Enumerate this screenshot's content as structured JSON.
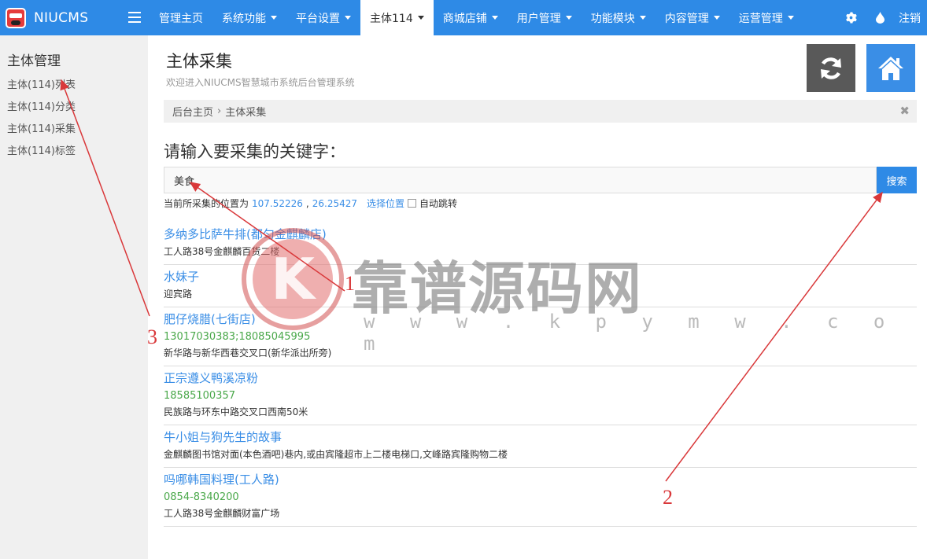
{
  "brand": {
    "name": "NIUCMS",
    "logo_text": "NIUCMS"
  },
  "menu": [
    {
      "label": "管理主页",
      "caret": false,
      "active": false
    },
    {
      "label": "系统功能",
      "caret": true,
      "active": false
    },
    {
      "label": "平台设置",
      "caret": true,
      "active": false
    },
    {
      "label": "主体114",
      "caret": true,
      "active": true
    },
    {
      "label": "商城店铺",
      "caret": true,
      "active": false
    },
    {
      "label": "用户管理",
      "caret": true,
      "active": false
    },
    {
      "label": "功能模块",
      "caret": true,
      "active": false
    },
    {
      "label": "内容管理",
      "caret": true,
      "active": false
    },
    {
      "label": "运营管理",
      "caret": true,
      "active": false
    }
  ],
  "nav_right": {
    "settings_icon": "gear-icon",
    "theme_icon": "drop-icon",
    "logout_label": "注销"
  },
  "sidebar": {
    "title": "主体管理",
    "items": [
      {
        "label": "主体(114)列表"
      },
      {
        "label": "主体(114)分类"
      },
      {
        "label": "主体(114)采集"
      },
      {
        "label": "主体(114)标签"
      }
    ]
  },
  "page": {
    "title": "主体采集",
    "subtitle": "欢迎进入NIUCMS智慧城市系统后台管理系统",
    "refresh_icon": "refresh-icon",
    "home_icon": "home-icon",
    "refresh_color": "#595959",
    "home_color": "#3a8ee6"
  },
  "breadcrumb": {
    "home": "后台主页",
    "sep": "›",
    "current": "主体采集",
    "close": "✖"
  },
  "search": {
    "label": "请输入要采集的关键字：",
    "value": "美食",
    "button": "搜索"
  },
  "location": {
    "prefix": "当前所采集的位置为",
    "lng": "107.52226",
    "sep": ",",
    "lat": "26.25427",
    "choose": "选择位置",
    "auto_jump": "自动跳转"
  },
  "results": [
    {
      "name": "多纳多比萨牛排(都匀金麒麟店)",
      "phone": "",
      "address": "工人路38号金麒麟百货二楼"
    },
    {
      "name": "水妹子",
      "phone": "",
      "address": "迎宾路"
    },
    {
      "name": "肥仔烧腊(七街店)",
      "phone": "13017030383;18085045995",
      "address": "新华路与新华西巷交叉口(新华派出所旁)"
    },
    {
      "name": "正宗遵义鸭溪凉粉",
      "phone": "18585100357",
      "address": "民族路与环东中路交叉口西南50米"
    },
    {
      "name": "牛小姐与狗先生的故事",
      "phone": "",
      "address": "金麒麟图书馆对面(本色酒吧)巷内,或由宾隆超市上二楼电梯口,文峰路宾隆购物二楼"
    },
    {
      "name": "吗哪韩国料理(工人路)",
      "phone": "0854-8340200",
      "address": "工人路38号金麒麟财富广场"
    }
  ],
  "watermark": {
    "logo_letter": "K",
    "text": "靠谱源码网",
    "url": "w w w . k p y m w . c o m"
  },
  "annotations": {
    "n1": "1",
    "n2": "2",
    "n3": "3",
    "color": "#d9383a"
  }
}
